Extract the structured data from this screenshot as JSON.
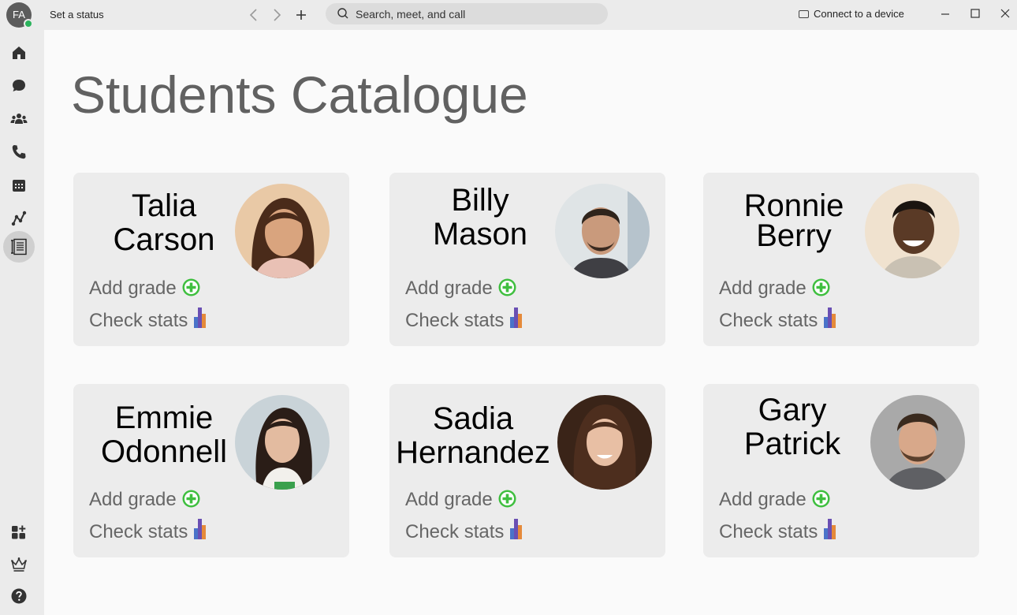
{
  "titlebar": {
    "avatar_initials": "FA",
    "set_status": "Set a status",
    "search_placeholder": "Search, meet, and call",
    "connect_device": "Connect to a device"
  },
  "rail": {
    "items": [
      "home-icon",
      "chat-icon",
      "teams-icon",
      "calls-icon",
      "calendar-icon",
      "activity-icon",
      "catalogue-app-icon"
    ],
    "bottom_items": [
      "apps-icon",
      "premium-icon",
      "help-icon"
    ]
  },
  "page": {
    "title": "Students Catalogue"
  },
  "students": [
    {
      "first": "Talia",
      "last": "Carson",
      "add_grade": "Add grade",
      "check_stats": "Check stats"
    },
    {
      "first": "Billy",
      "last": "Mason",
      "add_grade": "Add grade",
      "check_stats": "Check stats"
    },
    {
      "first": "Ronnie",
      "last": "Berry",
      "add_grade": "Add grade",
      "check_stats": "Check stats"
    },
    {
      "first": "Emmie",
      "last": "Odonnell",
      "add_grade": "Add grade",
      "check_stats": "Check stats"
    },
    {
      "first": "Sadia",
      "last": "Hernandez",
      "add_grade": "Add grade",
      "check_stats": "Check stats"
    },
    {
      "first": "Gary",
      "last": "Patrick",
      "add_grade": "Add grade",
      "check_stats": "Check stats"
    }
  ],
  "colors": {
    "accent_green": "#3fbf3f",
    "presence": "#2bb35c",
    "card_bg": "#ececec"
  }
}
